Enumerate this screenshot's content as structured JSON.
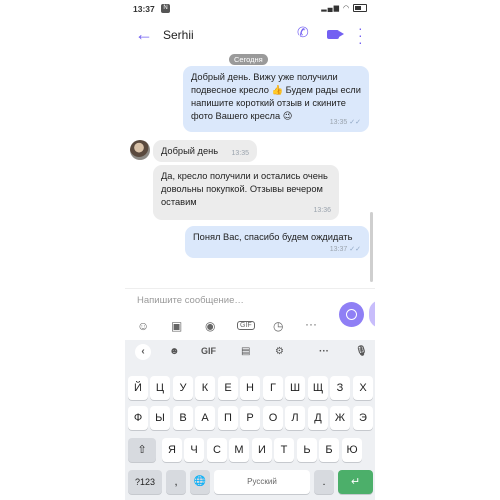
{
  "status": {
    "time": "13:37",
    "battery": "battery-icon"
  },
  "header": {
    "contact_name": "Serhii",
    "back_icon": "arrow-left-icon"
  },
  "chat": {
    "date_label": "Сегодня",
    "messages": [
      {
        "direction": "out",
        "text": "Добрый день. Вижу уже получили подвесное кресло 👍 Будем рады если напишите короткий отзыв и скините фото Вашего кресла 😉",
        "time": "13:35"
      },
      {
        "direction": "in",
        "text": "Добрый день",
        "time": "13:35"
      },
      {
        "direction": "in",
        "text": "Да, кресло получили и остались очень довольны покупкой. Отзывы вечером оставим",
        "time": "13:36"
      },
      {
        "direction": "out",
        "text": "Понял Вас, спасибо будем ождидать",
        "time": "13:37"
      }
    ]
  },
  "composer": {
    "placeholder": "Напишите сообщение…",
    "gif_label": "GIF"
  },
  "keyboard": {
    "toolbar_gif": "GIF",
    "row1": [
      "Й",
      "Ц",
      "У",
      "К",
      "Е",
      "Н",
      "Г",
      "Ш",
      "Щ",
      "З",
      "Х"
    ],
    "row2": [
      "Ф",
      "Ы",
      "В",
      "А",
      "П",
      "Р",
      "О",
      "Л",
      "Д",
      "Ж",
      "Э"
    ],
    "row3": [
      "Я",
      "Ч",
      "С",
      "М",
      "И",
      "Т",
      "Ь",
      "Б",
      "Ю"
    ],
    "num_key": "?123",
    "comma_key": ",",
    "space_label": "Русский",
    "period_key": "."
  }
}
